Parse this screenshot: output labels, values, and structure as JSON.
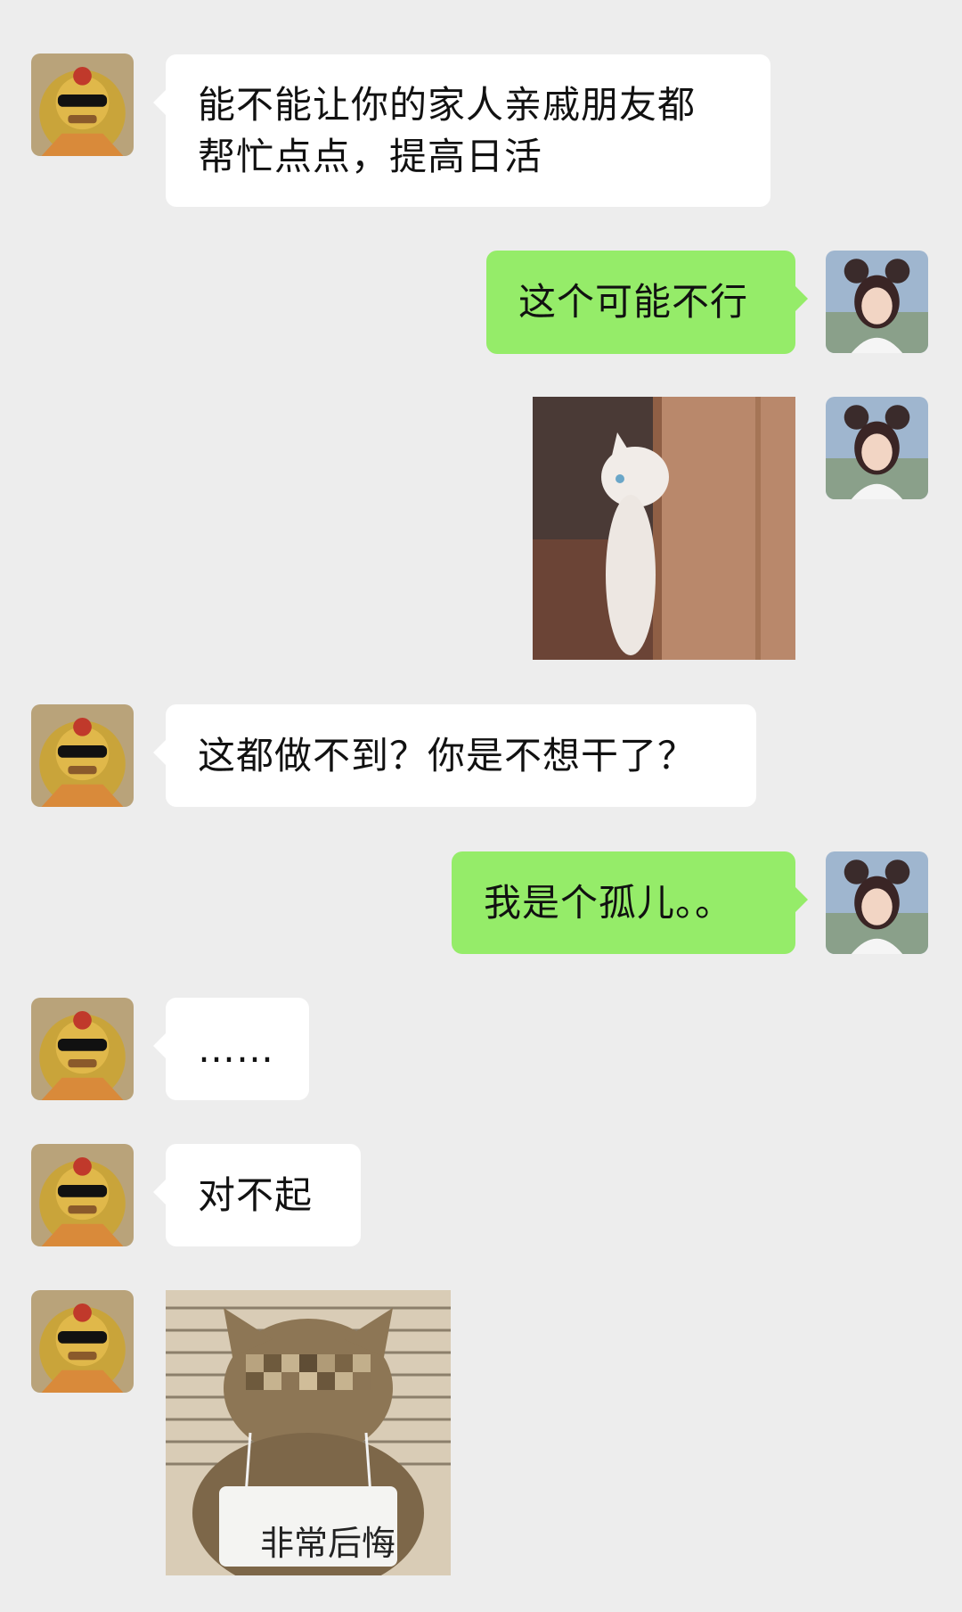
{
  "messages": [
    {
      "sender": "other",
      "type": "text",
      "text": "能不能让你的家人亲戚朋友都\n帮忙点点，提高日活"
    },
    {
      "sender": "me",
      "type": "text",
      "text": "这个可能不行"
    },
    {
      "sender": "me",
      "type": "sticker",
      "icon": "cat-peeking-behind-door"
    },
    {
      "sender": "other",
      "type": "text",
      "text": "这都做不到？你是不想干了？"
    },
    {
      "sender": "me",
      "type": "text",
      "text": "我是个孤儿。。"
    },
    {
      "sender": "other",
      "type": "text",
      "text": "……"
    },
    {
      "sender": "other",
      "type": "text",
      "text": "对不起"
    },
    {
      "sender": "other",
      "type": "sticker",
      "icon": "cat-mugshot-with-sign",
      "sign_text": "非常后悔"
    }
  ],
  "avatars": {
    "other": "lion-with-sunglasses-avatar",
    "me": "girl-with-mouse-ears-avatar"
  },
  "colors": {
    "background": "#ededed",
    "my_bubble": "#95ec69",
    "other_bubble": "#ffffff"
  }
}
